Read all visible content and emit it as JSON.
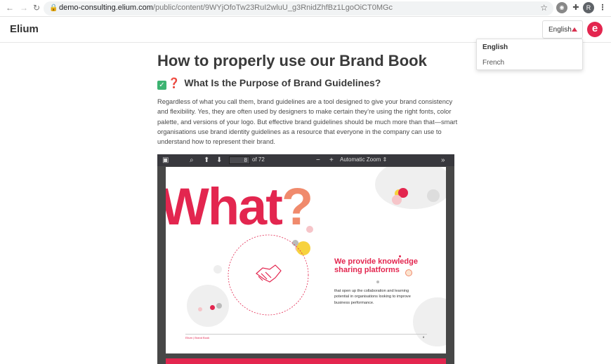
{
  "browser": {
    "url_host": "demo-consulting.elium.com",
    "url_path": "/public/content/9WYjOfoTw23RuI2wluU_g3RnidZhfBz1LgoOiCT0MGc",
    "avatar_letter": "R"
  },
  "header": {
    "logo": "Elium",
    "language_button": "English",
    "brand_icon_letter": "e"
  },
  "language_menu": {
    "options": [
      "English",
      "French"
    ],
    "selected": "English"
  },
  "article": {
    "title": "How to properly use our Brand Book",
    "subtitle": "What Is the Purpose of Brand Guidelines?",
    "subtitle_check": "✓",
    "subtitle_question": "❓",
    "paragraph": "Regardless of what you call them, brand guidelines are a tool designed to give your brand consistency and flexibility. Yes, they are often used by designers to make certain they’re using the right fonts, color palette, and versions of your logo. But effective brand guidelines should be much more than that—smart organisations use brand identity guidelines as a resource that everyone in the company can use to understand how to represent their brand."
  },
  "pdf_viewer": {
    "current_page": "8",
    "page_count_label": "of 72",
    "zoom_label": "Automatic Zoom",
    "page_content": {
      "headline": "What",
      "headline_mark": "?",
      "tagline": "We provide knowledge sharing platforms",
      "body": "that open up the collaboration and learning potential in organisations looking to improve business performance.",
      "footer_brand": "Elium | Brand Book"
    }
  },
  "colors": {
    "brand_red": "#e3264f",
    "accent_orange": "#f08a6c",
    "accent_yellow": "#f7d23e",
    "pdf_toolbar": "#38383d"
  },
  "icons": [
    "back-icon",
    "forward-icon",
    "reload-icon",
    "lock-icon",
    "star-icon",
    "extension-icon",
    "puzzle-icon",
    "menu-icon",
    "sidebar-toggle-icon",
    "search-icon",
    "arrow-up-icon",
    "arrow-down-icon",
    "zoom-out-icon",
    "zoom-in-icon",
    "tools-icon",
    "handshake-icon"
  ]
}
